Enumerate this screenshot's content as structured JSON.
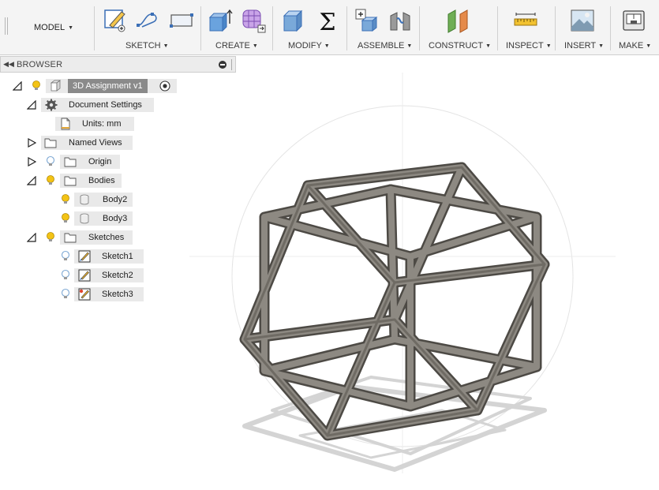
{
  "toolbar": {
    "model_label": "MODEL",
    "groups": [
      {
        "label": "SKETCH"
      },
      {
        "label": "CREATE"
      },
      {
        "label": "MODIFY"
      },
      {
        "label": "ASSEMBLE"
      },
      {
        "label": "CONSTRUCT"
      },
      {
        "label": "INSPECT"
      },
      {
        "label": "INSERT"
      },
      {
        "label": "MAKE"
      }
    ]
  },
  "browser": {
    "title": "BROWSER",
    "root": {
      "label": "3D Assignment v1"
    },
    "items": [
      {
        "label": "Document Settings"
      },
      {
        "label": "Units: mm"
      },
      {
        "label": "Named Views"
      },
      {
        "label": "Origin"
      },
      {
        "label": "Bodies"
      },
      {
        "label": "Body2"
      },
      {
        "label": "Body3"
      },
      {
        "label": "Sketches"
      },
      {
        "label": "Sketch1"
      },
      {
        "label": "Sketch2"
      },
      {
        "label": "Sketch3"
      }
    ]
  },
  "colors": {
    "frame_front": "#6f6b64",
    "frame_side": "#8d8982",
    "frame_dark": "#4d4a45",
    "shadow": "#d4d4d4",
    "bulb_on": "#f3c315",
    "bulb_off": "#a6c4e3"
  }
}
